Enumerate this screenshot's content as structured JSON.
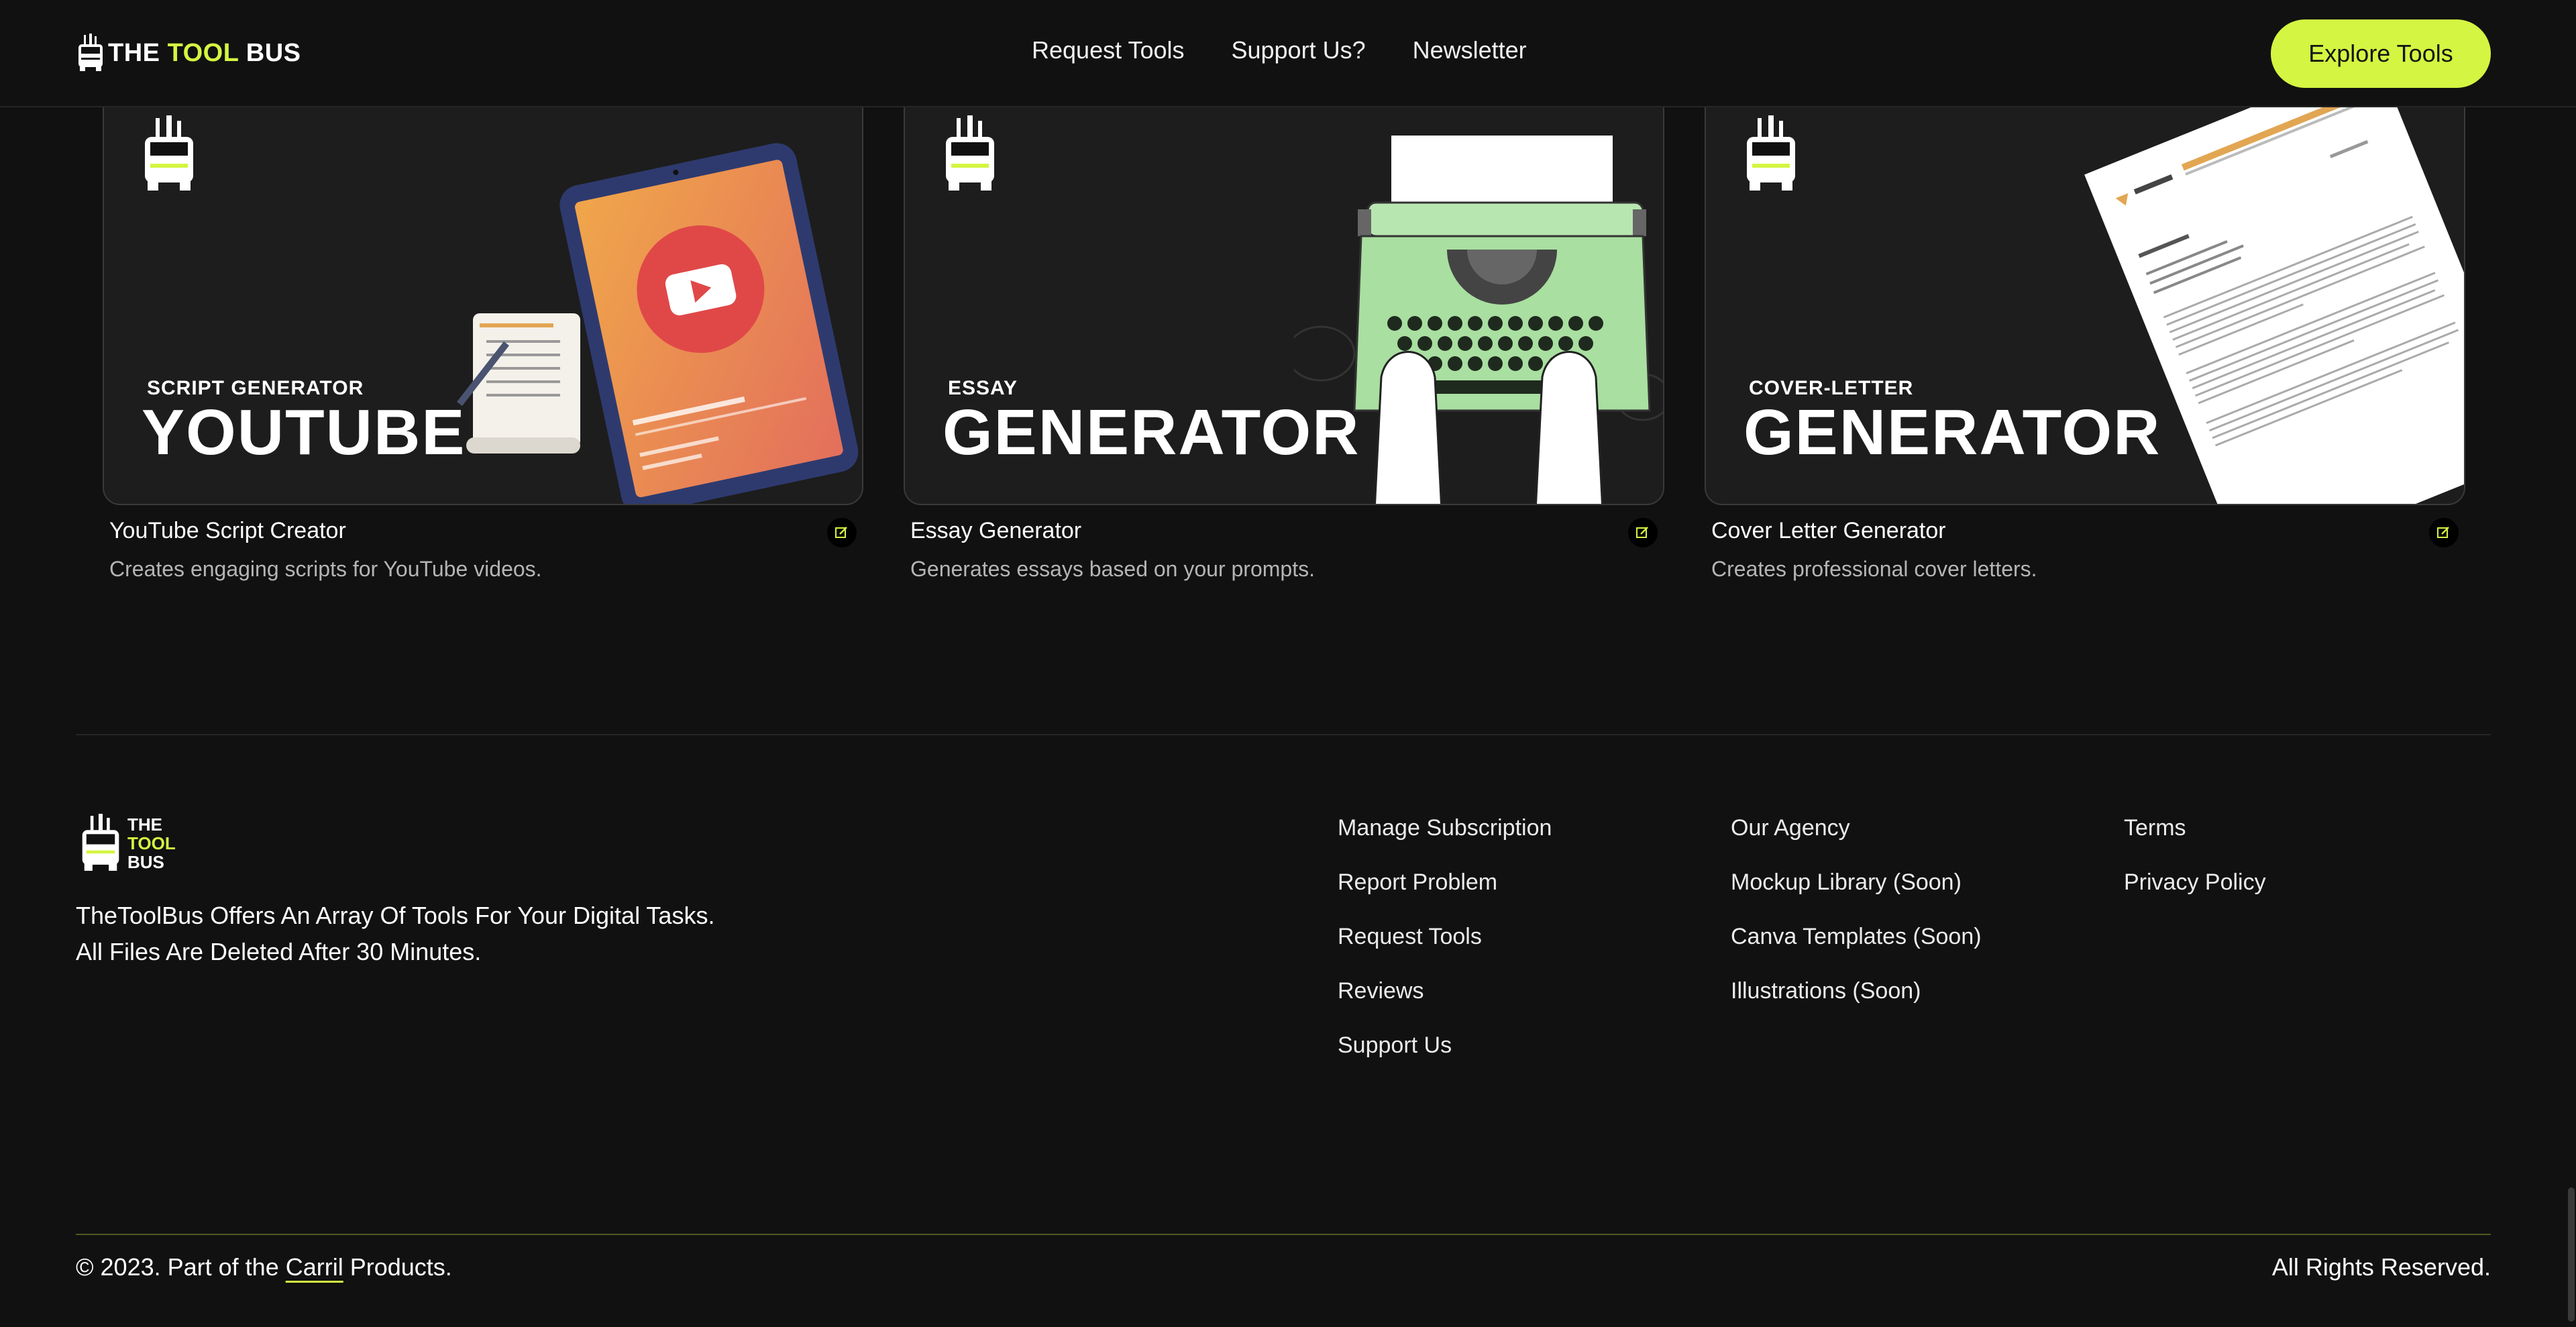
{
  "header": {
    "logo_text_pre": "THE ",
    "logo_text_accent": "TOOL",
    "logo_text_post": " BUS",
    "nav": [
      "Request Tools",
      "Support Us?",
      "Newsletter"
    ],
    "cta": "Explore Tools"
  },
  "cards": [
    {
      "image_small": "SCRIPT GENERATOR",
      "image_big": "YOUTUBE",
      "title": "YouTube Script Creator",
      "description": "Creates engaging scripts for YouTube videos."
    },
    {
      "image_small": "ESSAY",
      "image_big": "GENERATOR",
      "title": "Essay Generator",
      "description": "Generates essays based on your prompts."
    },
    {
      "image_small": "COVER-LETTER",
      "image_big": "GENERATOR",
      "title": "Cover Letter Generator",
      "description": "Creates professional cover letters."
    }
  ],
  "footer": {
    "logo_line1": "THE",
    "logo_line2": "TOOL",
    "logo_line3": "BUS",
    "tagline_line1": "TheToolBus Offers An Array Of Tools For Your Digital Tasks.",
    "tagline_line2": "All Files Are Deleted After 30 Minutes.",
    "col1": [
      "Manage Subscription",
      "Report Problem",
      "Request Tools",
      "Reviews",
      "Support Us"
    ],
    "col2": [
      "Our Agency",
      "Mockup Library (Soon)",
      "Canva Templates (Soon)",
      "Illustrations (Soon)"
    ],
    "col3": [
      "Terms",
      "Privacy Policy"
    ],
    "copyright_pre": "© 2023. Part of the ",
    "copyright_brand": "Carril",
    "copyright_post": " Products.",
    "rights": "All Rights Reserved."
  },
  "colors": {
    "accent": "#d4f542",
    "background": "#111111",
    "card_bg": "#1d1d1d",
    "muted_text": "#b5b5b5"
  },
  "icons": [
    "bus-logo-icon",
    "edit-icon",
    "play-icon"
  ]
}
